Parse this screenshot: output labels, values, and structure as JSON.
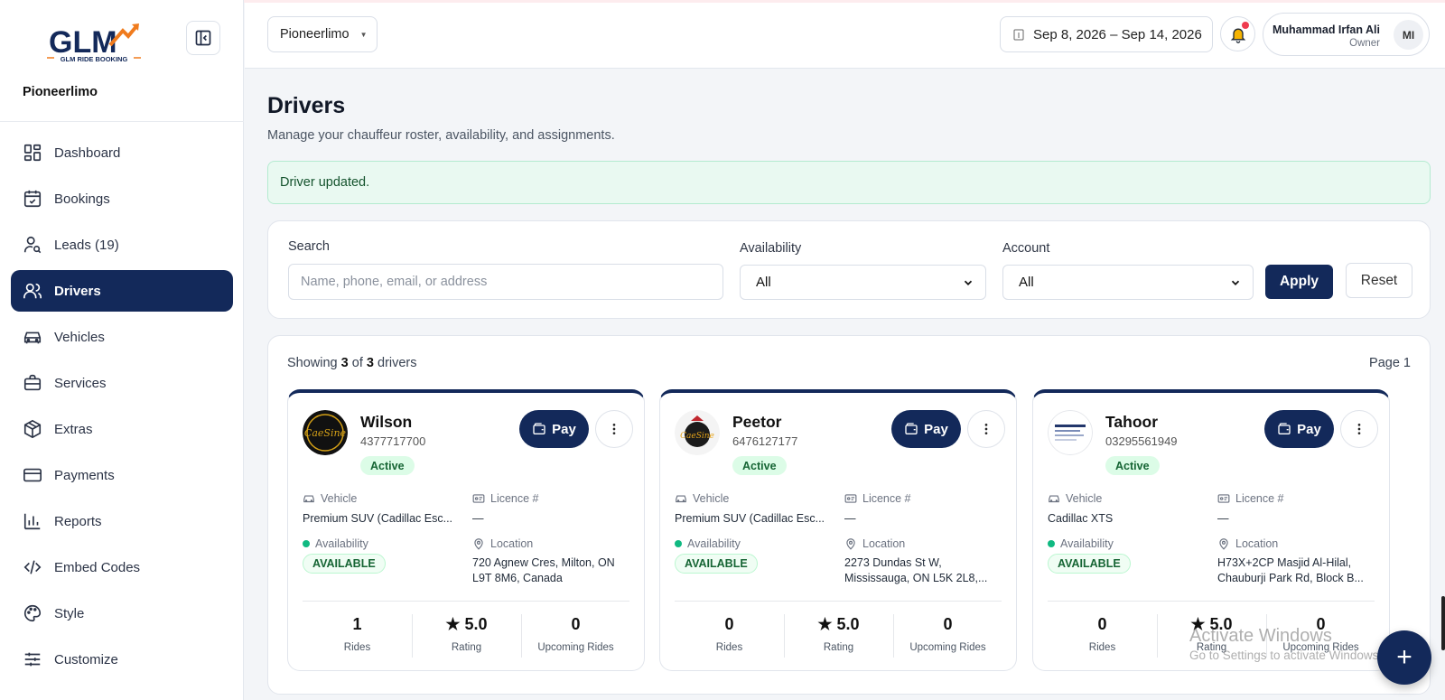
{
  "brand": {
    "logo_text": "GLM",
    "logo_sub": "GLM RIDE BOOKING",
    "company": "Pioneerlimo"
  },
  "sidebar": {
    "items": [
      {
        "label": "Dashboard",
        "icon": "dashboard-icon"
      },
      {
        "label": "Bookings",
        "icon": "calendar-icon"
      },
      {
        "label": "Leads (19)",
        "icon": "user-search-icon"
      },
      {
        "label": "Drivers",
        "icon": "users-icon",
        "active": true
      },
      {
        "label": "Vehicles",
        "icon": "car-icon"
      },
      {
        "label": "Services",
        "icon": "briefcase-icon"
      },
      {
        "label": "Extras",
        "icon": "package-icon"
      },
      {
        "label": "Payments",
        "icon": "credit-card-icon"
      },
      {
        "label": "Reports",
        "icon": "bar-chart-icon"
      },
      {
        "label": "Embed Codes",
        "icon": "code-icon"
      },
      {
        "label": "Style",
        "icon": "palette-icon"
      },
      {
        "label": "Customize",
        "icon": "sliders-icon"
      }
    ]
  },
  "topbar": {
    "org": "Pioneerlimo",
    "date_range": "Sep 8, 2026 – Sep 14, 2026",
    "user_name": "Muhammad Irfan Ali",
    "user_role": "Owner",
    "user_initials": "MI"
  },
  "page": {
    "title": "Drivers",
    "subtitle": "Manage your chauffeur roster, availability, and assignments.",
    "alert": "Driver updated."
  },
  "filters": {
    "search_label": "Search",
    "search_placeholder": "Name, phone, email, or address",
    "availability_label": "Availability",
    "availability_value": "All",
    "account_label": "Account",
    "account_value": "All",
    "apply": "Apply",
    "reset": "Reset"
  },
  "list": {
    "showing_prefix": "Showing",
    "shown": "3",
    "of": "of",
    "total": "3",
    "suffix": "drivers",
    "page": "Page 1"
  },
  "labels": {
    "pay": "Pay",
    "vehicle": "Vehicle",
    "licence": "Licence #",
    "availability": "Availability",
    "location": "Location",
    "rides": "Rides",
    "rating": "Rating",
    "upcoming": "Upcoming Rides"
  },
  "drivers": [
    {
      "name": "Wilson",
      "phone": "4377717700",
      "status": "Active",
      "vehicle": "Premium SUV (Cadillac Esc...",
      "licence": "—",
      "availability": "AVAILABLE",
      "location_1": "720 Agnew Cres, Milton, ON",
      "location_2": "L9T 8M6, Canada",
      "rides": "1",
      "rating": "★ 5.0",
      "upcoming": "0"
    },
    {
      "name": "Peetor",
      "phone": "6476127177",
      "status": "Active",
      "vehicle": "Premium SUV (Cadillac Esc...",
      "licence": "—",
      "availability": "AVAILABLE",
      "location_1": "2273 Dundas St W,",
      "location_2": "Mississauga, ON L5K 2L8,...",
      "rides": "0",
      "rating": "★ 5.0",
      "upcoming": "0"
    },
    {
      "name": "Tahoor",
      "phone": "03295561949",
      "status": "Active",
      "vehicle": "Cadillac XTS",
      "licence": "—",
      "availability": "AVAILABLE",
      "location_1": "H73X+2CP Masjid Al-Hilal,",
      "location_2": "Chauburji Park Rd, Block B...",
      "rides": "0",
      "rating": "★ 5.0",
      "upcoming": "0"
    }
  ],
  "watermark": {
    "line1": "Activate Windows",
    "line2": "Go to Settings to activate Windows."
  },
  "colors": {
    "primary": "#13295a",
    "success_bg": "#e9f9f1",
    "notify": "#ef3b4f",
    "bell": "#f5b301"
  }
}
